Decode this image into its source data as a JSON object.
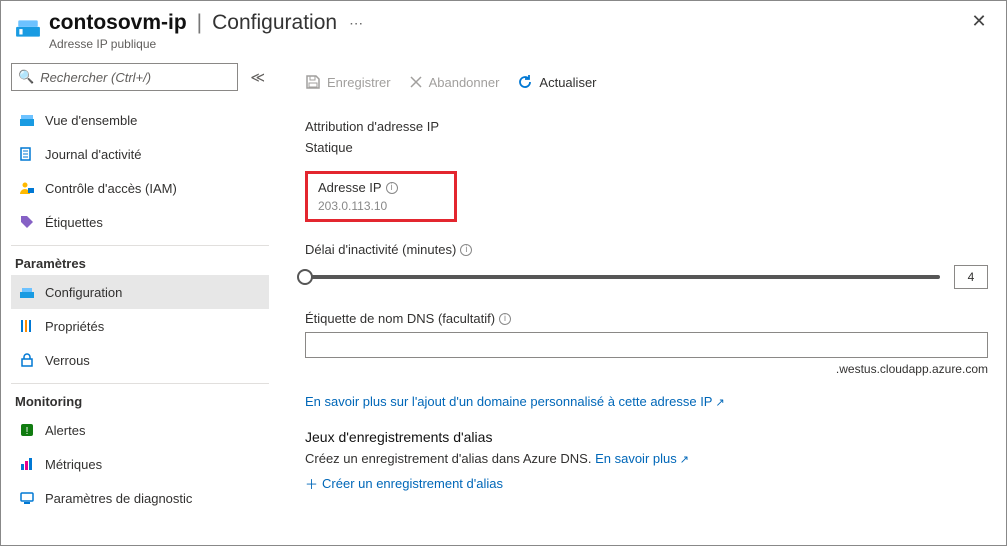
{
  "header": {
    "resource": "contosovm-ip",
    "page": "Configuration",
    "subtitle": "Adresse IP publique"
  },
  "search": {
    "placeholder": "Rechercher (Ctrl+/)"
  },
  "sidebar": {
    "items_top": [
      {
        "label": "Vue d'ensemble"
      },
      {
        "label": "Journal d'activité"
      },
      {
        "label": "Contrôle d'accès (IAM)"
      },
      {
        "label": "Étiquettes"
      }
    ],
    "group_params": "Paramètres",
    "items_params": [
      {
        "label": "Configuration"
      },
      {
        "label": "Propriétés"
      },
      {
        "label": "Verrous"
      }
    ],
    "group_monitoring": "Monitoring",
    "items_monitoring": [
      {
        "label": "Alertes"
      },
      {
        "label": "Métriques"
      },
      {
        "label": "Paramètres de diagnostic"
      }
    ]
  },
  "toolbar": {
    "save": "Enregistrer",
    "discard": "Abandonner",
    "refresh": "Actualiser"
  },
  "content": {
    "assignment_label": "Attribution d'adresse IP",
    "assignment_value": "Statique",
    "ip_label": "Adresse IP",
    "ip_value": "203.0.113.10",
    "idle_label": "Délai d'inactivité (minutes)",
    "idle_value": "4",
    "dns_label": "Étiquette de nom DNS (facultatif)",
    "dns_value": "",
    "dns_suffix": ".westus.cloudapp.azure.com",
    "learn_custom_domain": "En savoir plus sur l'ajout d'un domaine personnalisé à cette adresse IP",
    "alias_title": "Jeux d'enregistrements d'alias",
    "alias_desc1": "Créez un enregistrement d'alias dans Azure DNS. ",
    "alias_desc_link": "En savoir plus",
    "alias_create": "Créer un enregistrement d'alias"
  }
}
